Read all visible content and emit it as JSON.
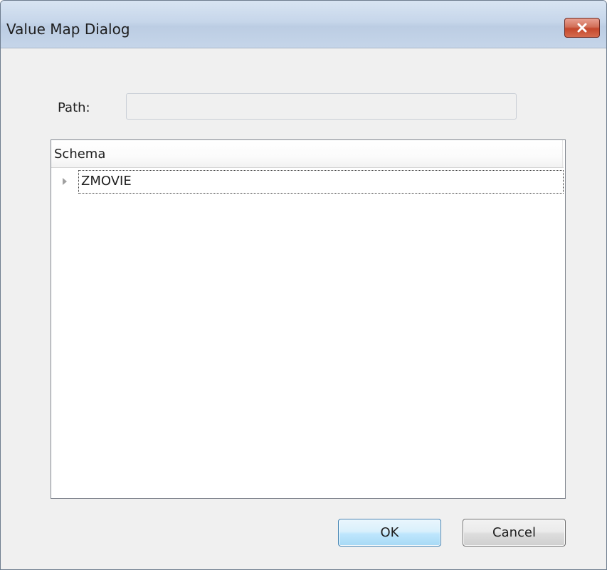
{
  "window": {
    "title": "Value Map Dialog",
    "close_icon": "close-icon"
  },
  "path": {
    "label": "Path:",
    "value": "",
    "placeholder": ""
  },
  "tree": {
    "column_header": "Schema",
    "items": [
      {
        "label": "ZMOVIE",
        "expander_icon": "triangle-right-icon",
        "expanded": false,
        "focused": true
      }
    ]
  },
  "buttons": {
    "ok_label": "OK",
    "cancel_label": "Cancel"
  },
  "colors": {
    "dialog_background": "#f0f0f0",
    "close_button": "#c4472c",
    "default_button_border": "#3c7fb1"
  }
}
